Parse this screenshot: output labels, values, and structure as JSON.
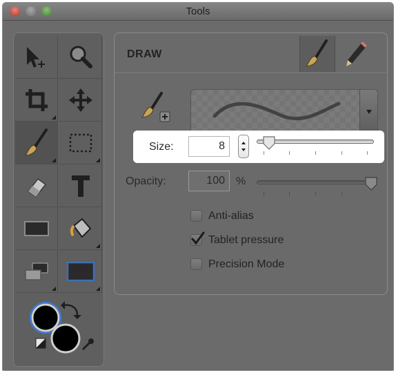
{
  "window": {
    "title": "Tools"
  },
  "toolbox": {
    "tools": [
      {
        "name": "selection-tool",
        "icon": "arrow-move-icon"
      },
      {
        "name": "zoom-tool",
        "icon": "magnifier-icon"
      },
      {
        "name": "crop-tool",
        "icon": "crop-icon"
      },
      {
        "name": "pan-tool",
        "icon": "move-arrows-icon"
      },
      {
        "name": "brush-tool",
        "icon": "paintbrush-icon",
        "active": true
      },
      {
        "name": "marquee-tool",
        "icon": "dotted-rectangle-icon"
      },
      {
        "name": "eraser-tool",
        "icon": "eraser-icon"
      },
      {
        "name": "text-tool",
        "icon": "text-t-icon"
      },
      {
        "name": "rectangle-tool",
        "icon": "rectangle-icon"
      },
      {
        "name": "fill-tool",
        "icon": "paint-bucket-icon"
      },
      {
        "name": "layers-tool",
        "icon": "layers-icon"
      },
      {
        "name": "shape-tool",
        "icon": "framed-rectangle-icon"
      }
    ],
    "colors": {
      "foreground": "#000000",
      "background": "#000000"
    }
  },
  "panel": {
    "title": "DRAW",
    "modes": [
      {
        "name": "brush-mode",
        "icon": "brush-mode-icon",
        "active": true
      },
      {
        "name": "pencil-mode",
        "icon": "pencil-icon",
        "active": false
      }
    ],
    "size": {
      "label": "Size:",
      "value": "8",
      "slider_fraction": 0.08
    },
    "opacity": {
      "label": "Opacity:",
      "value": "100",
      "unit": "%",
      "slider_fraction": 1.0
    },
    "checkboxes": [
      {
        "label": "Anti-alias",
        "checked": false
      },
      {
        "label": "Tablet pressure",
        "checked": true
      },
      {
        "label": "Precision Mode",
        "checked": false
      }
    ]
  }
}
